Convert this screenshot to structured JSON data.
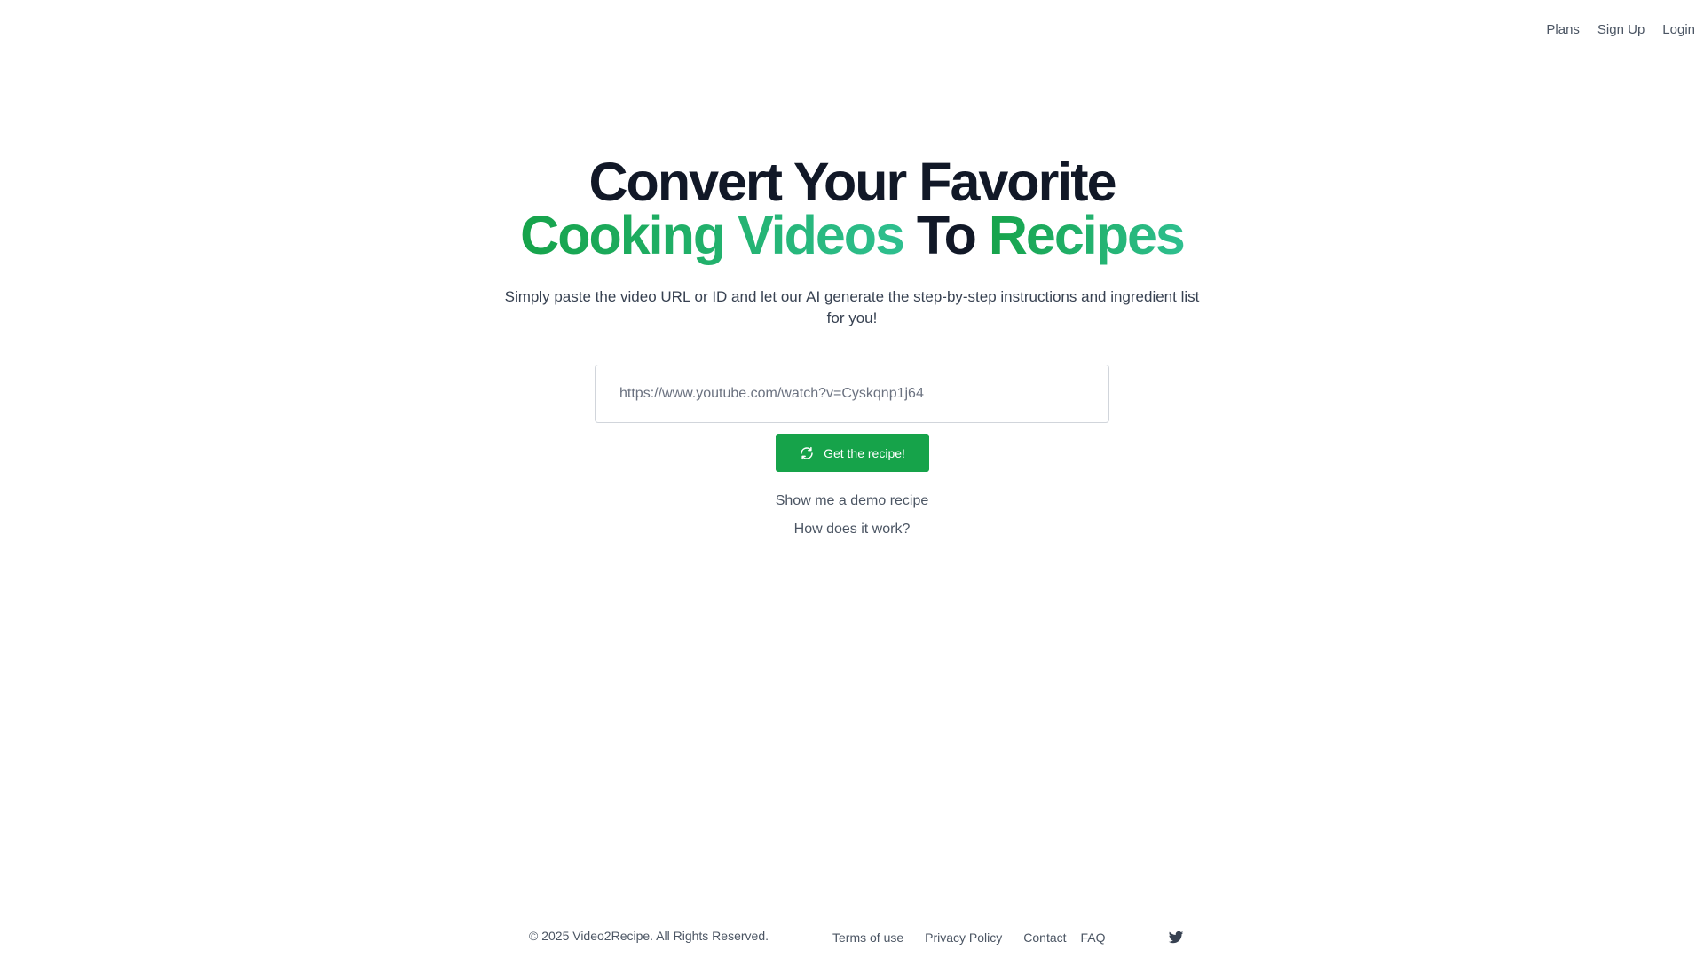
{
  "nav": {
    "plans": "Plans",
    "signup": "Sign Up",
    "login": "Login"
  },
  "hero": {
    "line1": "Convert Your Favorite",
    "cooking_videos": "Cooking Videos",
    "to": " To ",
    "recipes": "Recipes",
    "subtitle": "Simply paste the video URL or ID and let our AI generate the step-by-step instructions and ingredient list for you!"
  },
  "input": {
    "placeholder": "https://www.youtube.com/watch?v=Cyskqnp1j64",
    "value": ""
  },
  "button": {
    "label": "Get the recipe!",
    "icon": "refresh-icon"
  },
  "links": {
    "demo": "Show me a demo recipe",
    "how": "How does it work?"
  },
  "footer": {
    "copyright": "© 2025 Video2Recipe. All Rights Reserved.",
    "terms": "Terms of use",
    "privacy": "Privacy Policy",
    "contact": "Contact",
    "faq": "FAQ",
    "social_icon": "twitter-icon"
  },
  "colors": {
    "brand_green": "#16a34a",
    "gradient_end": "#2ebf8f",
    "text_dark": "#111827",
    "text_muted": "#4b5563"
  }
}
